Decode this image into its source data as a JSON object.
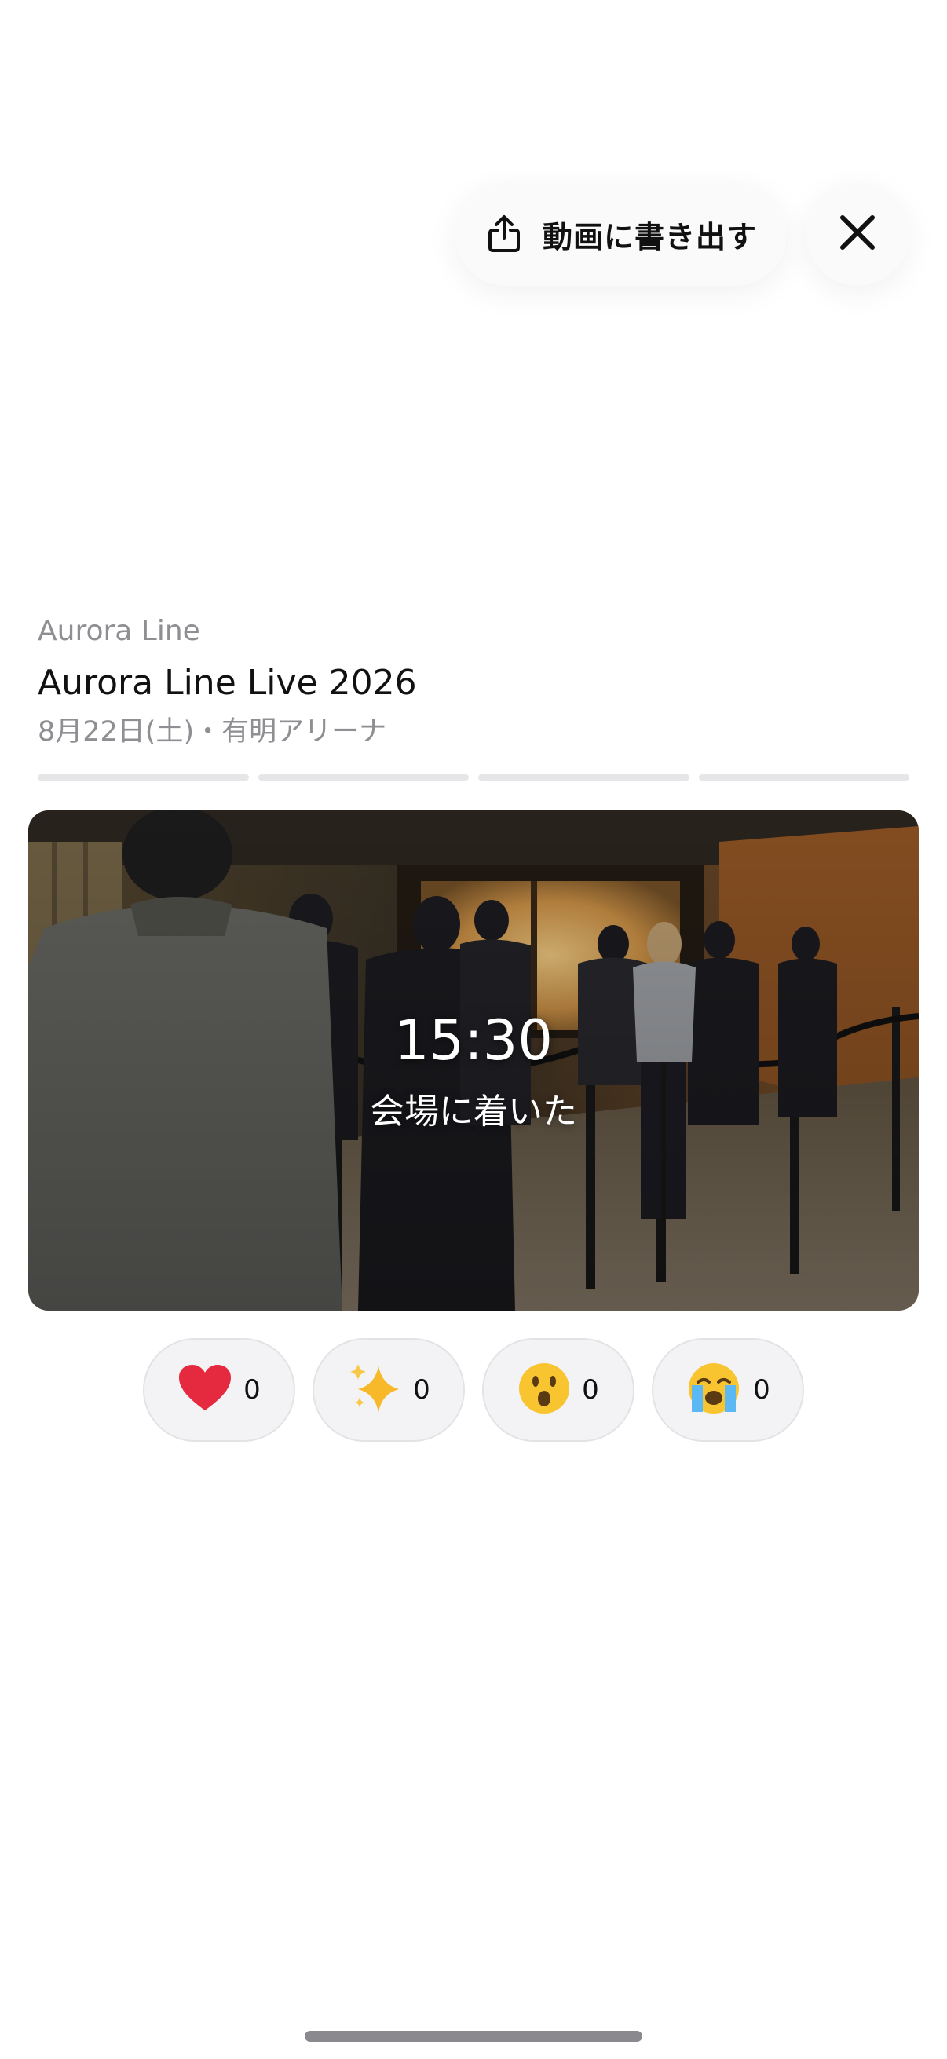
{
  "toolbar": {
    "export_label": "動画に書き出す",
    "export_icon": "share-icon",
    "close_icon": "close-icon"
  },
  "event": {
    "artist": "Aurora Line",
    "title": "Aurora Line Live 2026",
    "meta": "8月22日(土)・有明アリーナ"
  },
  "progress": {
    "segments": 4
  },
  "story": {
    "time": "15:30",
    "caption": "会場に着いた",
    "image": "photo of people queueing behind stanchion rope into a venue entrance"
  },
  "reactions": [
    {
      "icon": "heart-icon",
      "count": "0"
    },
    {
      "icon": "sparkles-icon",
      "count": "0"
    },
    {
      "icon": "surprised-face-icon",
      "count": "0"
    },
    {
      "icon": "crying-face-icon",
      "count": "0"
    }
  ],
  "colors": {
    "accent_red": "#e5293e",
    "muted_text": "#8e8e93",
    "pill_bg": "#f3f3f5"
  }
}
